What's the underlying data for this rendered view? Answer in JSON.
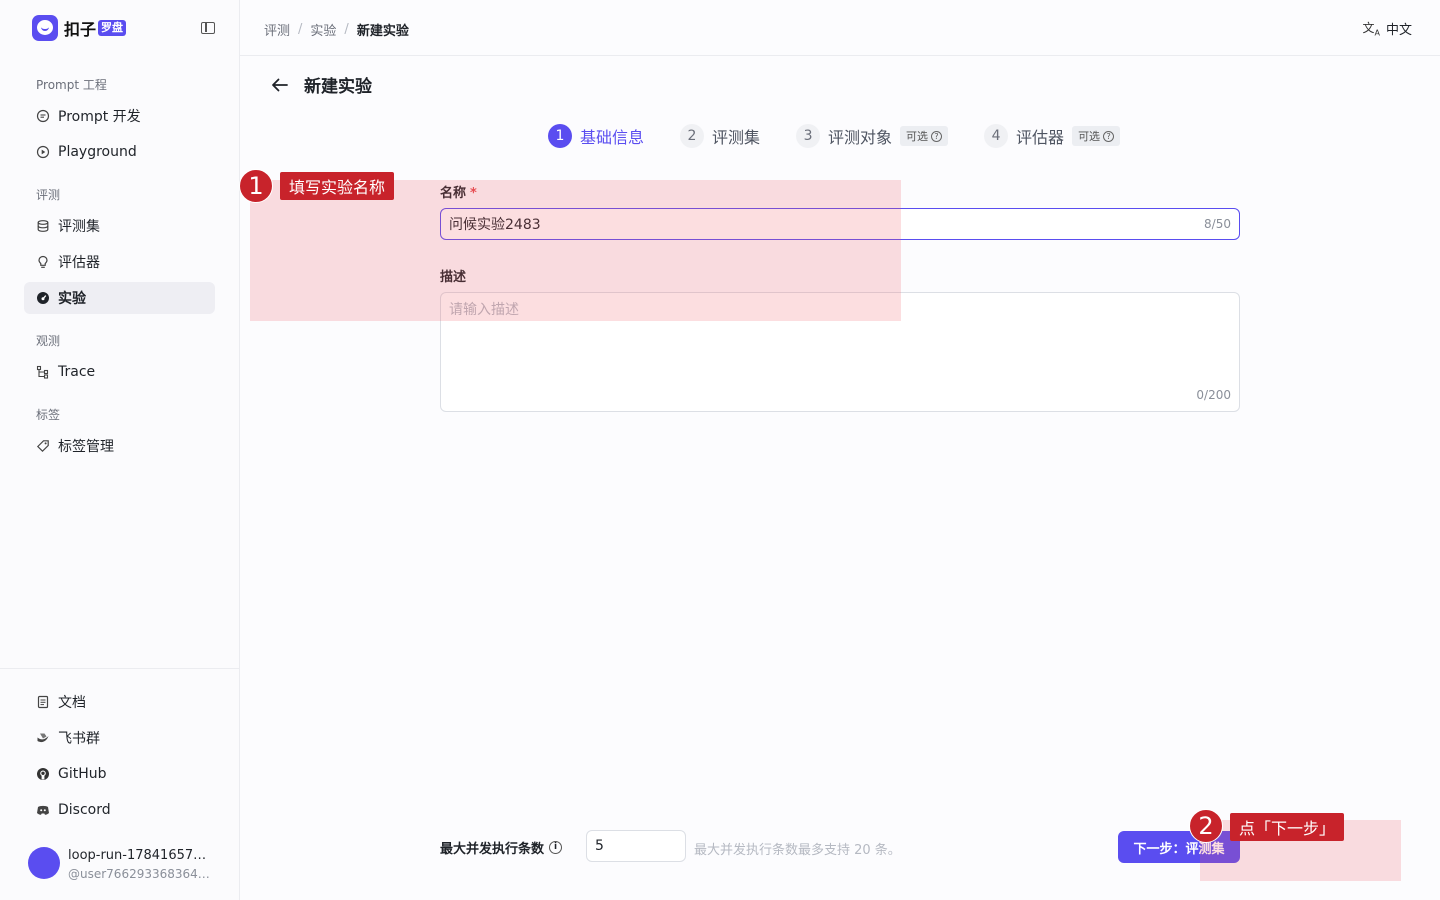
{
  "brand": {
    "name": "扣子",
    "badge": "罗盘"
  },
  "sidebar": {
    "groups": [
      {
        "label": "Prompt 工程",
        "items": [
          {
            "label": "Prompt 开发",
            "icon": "prompt-icon"
          },
          {
            "label": "Playground",
            "icon": "play-icon"
          }
        ]
      },
      {
        "label": "评测",
        "items": [
          {
            "label": "评测集",
            "icon": "database-icon"
          },
          {
            "label": "评估器",
            "icon": "bulb-icon"
          },
          {
            "label": "实验",
            "icon": "dashboard-icon",
            "active": true
          }
        ]
      },
      {
        "label": "观测",
        "items": [
          {
            "label": "Trace",
            "icon": "trace-icon"
          }
        ]
      },
      {
        "label": "标签",
        "items": [
          {
            "label": "标签管理",
            "icon": "tag-icon"
          }
        ]
      }
    ],
    "bottom": [
      {
        "label": "文档",
        "icon": "doc-icon"
      },
      {
        "label": "飞书群",
        "icon": "feishu-icon"
      },
      {
        "label": "GitHub",
        "icon": "github-icon"
      },
      {
        "label": "Discord",
        "icon": "discord-icon"
      }
    ],
    "user": {
      "name": "loop-run-178416577…",
      "id": "@user7662933683648…"
    }
  },
  "breadcrumb": [
    "评测",
    "实验",
    "新建实验"
  ],
  "language": "中文",
  "page_title": "新建实验",
  "steps": [
    {
      "num": "1",
      "label": "基础信息",
      "active": true
    },
    {
      "num": "2",
      "label": "评测集"
    },
    {
      "num": "3",
      "label": "评测对象",
      "optional": "可选"
    },
    {
      "num": "4",
      "label": "评估器",
      "optional": "可选"
    }
  ],
  "form": {
    "name_label": "名称",
    "name_required": "*",
    "name_value": "问候实验2483",
    "name_count": "8/50",
    "desc_label": "描述",
    "desc_placeholder": "请输入描述",
    "desc_count": "0/200"
  },
  "footer": {
    "concurrency_label": "最大并发执行条数",
    "concurrency_value": "5",
    "concurrency_hint": "最大并发执行条数最多支持 20 条。",
    "next_button": "下一步：评测集"
  },
  "annotations": [
    {
      "num": "1",
      "label": "填写实验名称"
    },
    {
      "num": "2",
      "label": "点「下一步」"
    }
  ],
  "colors": {
    "accent": "#5a4df0",
    "annotation": "#c8232b"
  }
}
